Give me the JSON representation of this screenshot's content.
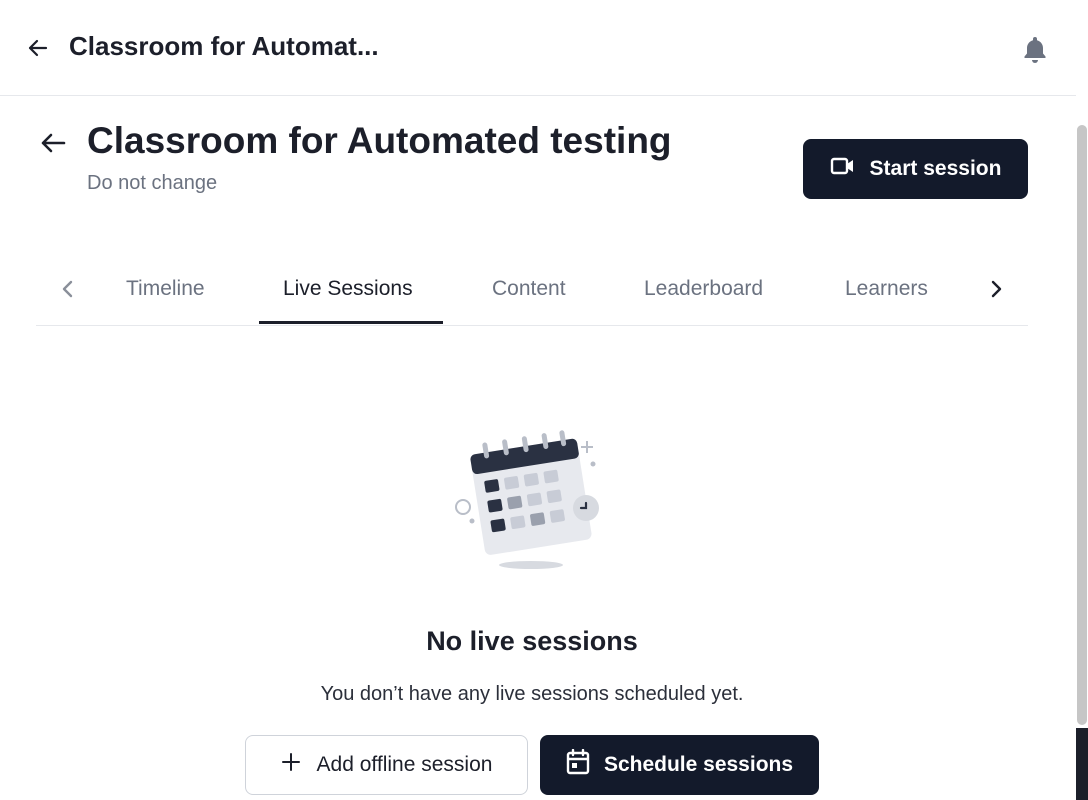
{
  "topbar": {
    "title": "Classroom for Automat...",
    "back_icon": "arrow-left-icon",
    "bell_icon": "bell-icon"
  },
  "classroom": {
    "title": "Classroom for Automated testing",
    "subtitle": "Do not change"
  },
  "actions": {
    "start_session_label": "Start session",
    "start_session_icon": "video-camera-icon"
  },
  "tabs": {
    "items": [
      "Timeline",
      "Live Sessions",
      "Content",
      "Leaderboard",
      "Learners"
    ],
    "active": "Live Sessions"
  },
  "empty_state": {
    "title": "No live sessions",
    "text": "You don’t have any live sessions scheduled yet.",
    "add_offline_label": "Add offline session",
    "schedule_label": "Schedule sessions"
  },
  "colors": {
    "primary": "#131a2b",
    "muted_text": "#6b7280",
    "border": "#e6e8ec"
  }
}
